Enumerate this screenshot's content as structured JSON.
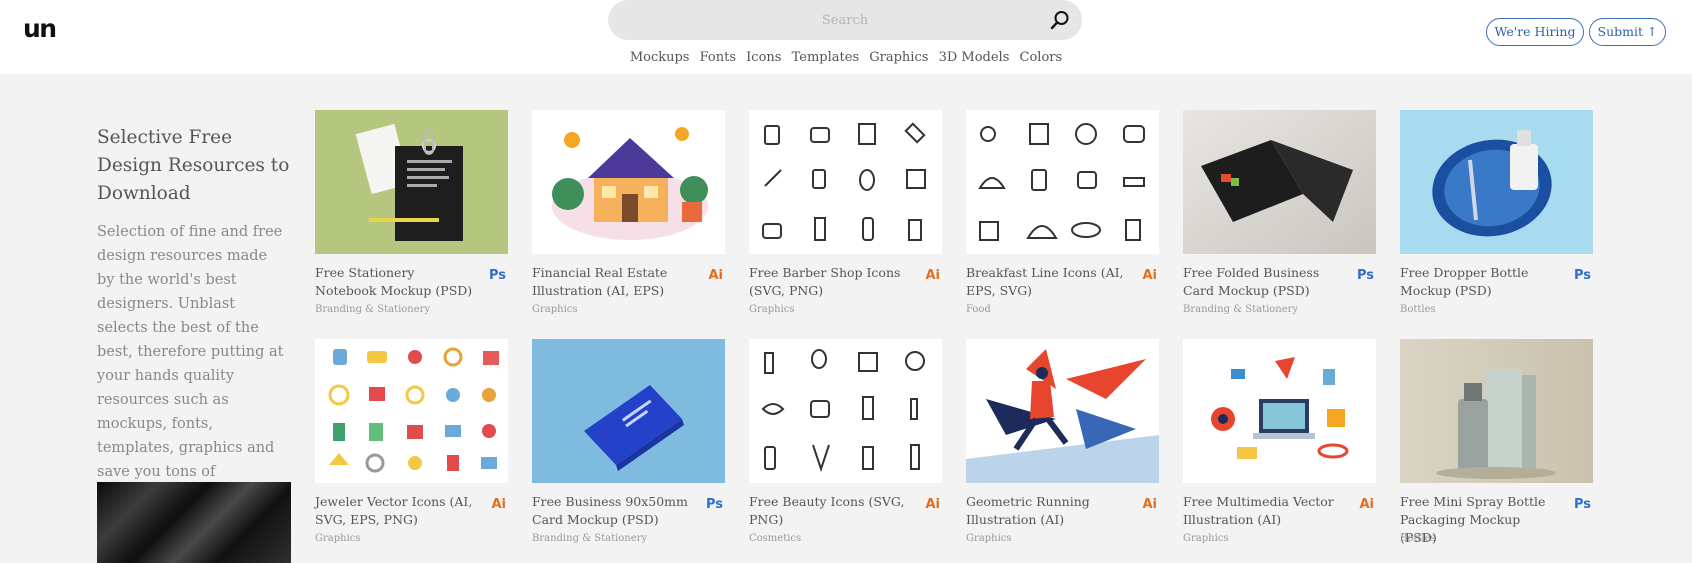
{
  "header": {
    "logo_text": "un",
    "search_placeholder": "Search",
    "nav": [
      "Mockups",
      "Fonts",
      "Icons",
      "Templates",
      "Graphics",
      "3D Models",
      "Colors"
    ],
    "hiring_label": "We're Hiring",
    "submit_label": "Submit ↑"
  },
  "intro": {
    "title": "Selective Free Design Resources to Download",
    "text": "Selection of fine and free design resources made by the world's best designers. Unblast selects the best of the best, therefore putting at your hands quality resources such as mockups, fonts, templates, graphics and save you tons of searching hours."
  },
  "colors": {
    "accent_blue": "#2e6fd0",
    "ai_orange": "#e0701f",
    "page_bg": "#f3f3f3"
  },
  "cards": [
    {
      "title": "Free Stationery Notebook Mockup (PSD)",
      "badge": "Ps",
      "category": "Branding & Stationery"
    },
    {
      "title": "Financial Real Estate Illustration (AI, EPS)",
      "badge": "Ai",
      "category": "Graphics"
    },
    {
      "title": "Free Barber Shop Icons (SVG, PNG)",
      "badge": "Ai",
      "category": "Graphics"
    },
    {
      "title": "Breakfast Line Icons (AI, EPS, SVG)",
      "badge": "Ai",
      "category": "Food"
    },
    {
      "title": "Free Folded Business Card Mockup (PSD)",
      "badge": "Ps",
      "category": "Branding & Stationery"
    },
    {
      "title": "Free Dropper Bottle Mockup (PSD)",
      "badge": "Ps",
      "category": "Bottles"
    },
    {
      "title": "Jeweler Vector Icons (AI, SVG, EPS, PNG)",
      "badge": "Ai",
      "category": "Graphics"
    },
    {
      "title": "Free Business 90x50mm Card Mockup (PSD)",
      "badge": "Ps",
      "category": "Branding & Stationery"
    },
    {
      "title": "Free Beauty Icons (SVG, PNG)",
      "badge": "Ai",
      "category": "Cosmetics"
    },
    {
      "title": "Geometric Running Illustration (AI)",
      "badge": "Ai",
      "category": "Graphics"
    },
    {
      "title": "Free Multimedia Vector Illustration (AI)",
      "badge": "Ai",
      "category": "Graphics"
    },
    {
      "title": "Free Mini Spray Bottle Packaging Mockup (PSD)",
      "badge": "Ps",
      "category": "Bottles"
    }
  ]
}
